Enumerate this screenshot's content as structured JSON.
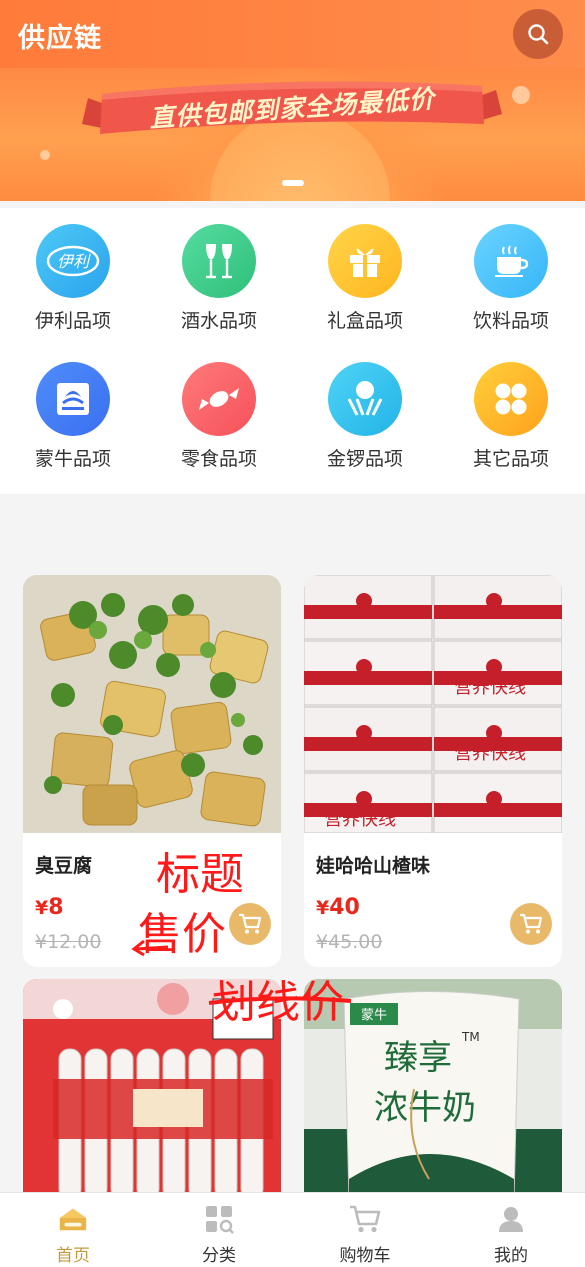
{
  "header": {
    "title": "供应链"
  },
  "banner": {
    "slogan": "直供包邮到家全场最低价"
  },
  "categories": [
    {
      "label": "伊利品项",
      "icon": "yili-logo-icon",
      "mark": "伊利",
      "color_from": "#4ec9f5",
      "color_to": "#2aa3ee"
    },
    {
      "label": "酒水品项",
      "icon": "wine-glasses-icon",
      "color_from": "#55dca0",
      "color_to": "#2fbf7a"
    },
    {
      "label": "礼盒品项",
      "icon": "gift-box-icon",
      "color_from": "#ffd54a",
      "color_to": "#ffb51e"
    },
    {
      "label": "饮料品项",
      "icon": "coffee-cup-icon",
      "color_from": "#6ad3ff",
      "color_to": "#36b6f7"
    },
    {
      "label": "蒙牛品项",
      "icon": "mengniu-logo-icon",
      "color_from": "#4f8dfb",
      "color_to": "#3a6ff0"
    },
    {
      "label": "零食品项",
      "icon": "candy-icon",
      "color_from": "#ff7a7a",
      "color_to": "#f5515a"
    },
    {
      "label": "金锣品项",
      "icon": "jinluo-logo-icon",
      "color_from": "#4fd3f5",
      "color_to": "#22b4e8"
    },
    {
      "label": "其它品项",
      "icon": "grid-four-icon",
      "color_from": "#ffcf3a",
      "color_to": "#ffa21c"
    }
  ],
  "products": [
    {
      "name": "臭豆腐",
      "currency": "¥",
      "price": "8",
      "market_price": "¥12.00",
      "image": "stinky-tofu-photo"
    },
    {
      "name": "娃哈哈山楂味",
      "currency": "¥",
      "price": "40",
      "market_price": "¥45.00",
      "image": "wahaha-boxes-photo",
      "image_text": "营养快线"
    },
    {
      "name": "",
      "image": "wahaha-ad-milk-photo"
    },
    {
      "name": "",
      "image": "mengniu-zhenxiang-milk-photo",
      "image_text": {
        "brand": "蒙牛",
        "title": "臻享",
        "sub": "浓牛奶",
        "tm": "TM"
      }
    }
  ],
  "annotations": {
    "title": "标题",
    "price": "售价",
    "strike": "划线价"
  },
  "tabs": [
    {
      "label": "首页",
      "icon": "home-icon",
      "active": true
    },
    {
      "label": "分类",
      "icon": "category-icon",
      "active": false
    },
    {
      "label": "购物车",
      "icon": "cart-icon",
      "active": false
    },
    {
      "label": "我的",
      "icon": "user-icon",
      "active": false
    }
  ],
  "colors": {
    "accent": "#ff7b3a",
    "price": "#e8281d",
    "tab_active": "#c49a3e",
    "cart_button": "#e9b96a"
  }
}
